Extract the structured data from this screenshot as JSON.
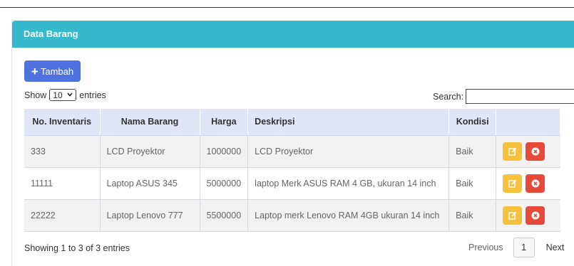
{
  "card": {
    "title": "Data Barang"
  },
  "toolbar": {
    "add_label": "Tambah",
    "add_icon": "plus-icon"
  },
  "length": {
    "show_label": "Show",
    "selected": "10",
    "entries_label": "entries"
  },
  "search": {
    "label": "Search:",
    "value": ""
  },
  "table": {
    "headers": [
      "No. Inventaris",
      "Nama Barang",
      "Harga",
      "Deskripsi",
      "Kondisi",
      ""
    ],
    "rows": [
      {
        "no": "333",
        "nama": "LCD Proyektor",
        "harga": "1000000",
        "deskripsi": "LCD Proyektor",
        "kondisi": "Baik"
      },
      {
        "no": "11111",
        "nama": "Laptop ASUS 345",
        "harga": "5000000",
        "deskripsi": "laptop Merk ASUS RAM 4 GB, ukuran 14 inch",
        "kondisi": "Baik"
      },
      {
        "no": "22222",
        "nama": "Laptop Lenovo 777",
        "harga": "5500000",
        "deskripsi": "Laptop merk Lenovo RAM 4GB ukuran 14 inch",
        "kondisi": "Baik"
      }
    ]
  },
  "footer": {
    "info": "Showing 1 to 3 of 3 entries",
    "previous": "Previous",
    "page": "1",
    "next": "Next"
  },
  "colors": {
    "header": "#36b9cc",
    "primary": "#4e73df",
    "warning": "#f6c23e",
    "danger": "#e74a3b"
  }
}
